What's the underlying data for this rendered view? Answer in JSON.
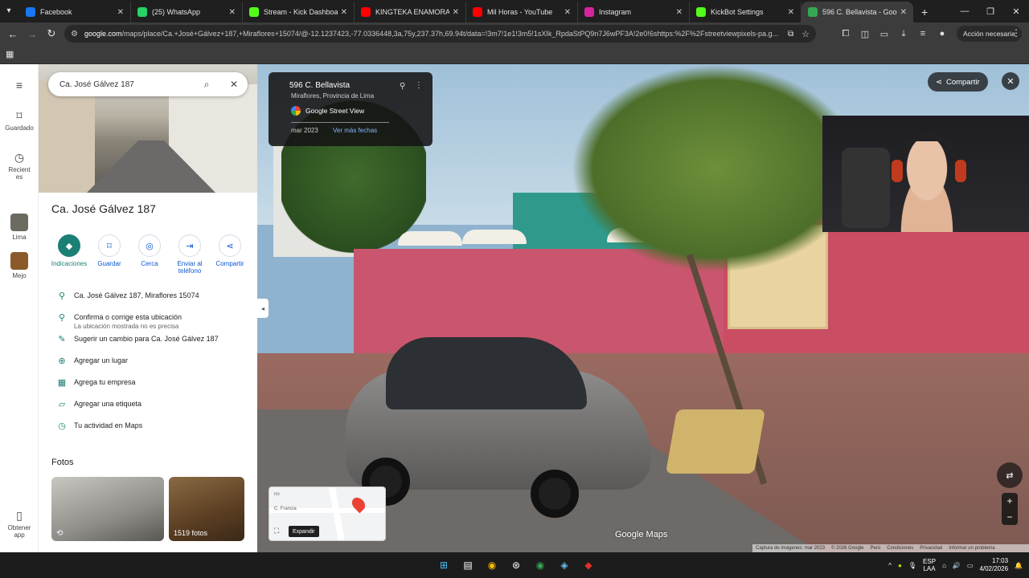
{
  "browser": {
    "tabs": [
      {
        "title": "Facebook",
        "color": "#1877f2",
        "active": false
      },
      {
        "title": "(25) WhatsApp",
        "color": "#25d366",
        "active": false
      },
      {
        "title": "Stream - Kick Dashboard",
        "color": "#53fc18",
        "active": false
      },
      {
        "title": "KINGTEKA ENAMORA",
        "color": "#ff0000",
        "active": false
      },
      {
        "title": "Mil Horas - YouTube",
        "color": "#ff0000",
        "active": false
      },
      {
        "title": "Instagram",
        "color": "#d6249f",
        "active": false
      },
      {
        "title": "KickBot Settings",
        "color": "#53fc18",
        "active": false
      },
      {
        "title": "596 C. Bellavista - Google",
        "color": "#34a853",
        "active": true
      }
    ],
    "url_host": "google.com",
    "url_rest": "/maps/place/Ca.+José+Gálvez+187,+Miraflores+15074/@-12.1237423,-77.0336448,3a,75y,237.37h,69.94t/data=!3m7!1e1!3m5!1sXIk_RpdaStPQ9n7J6wPF3A!2e0!6shttps:%2F%2Fstreetviewpixels-pa.g...",
    "action_label": "Acción necesaria"
  },
  "rail": {
    "items": [
      {
        "label": "Guardado",
        "icon": "bookmark-icon"
      },
      {
        "label": "Recientes",
        "icon": "history-icon"
      },
      {
        "label": "Lima",
        "icon": "thumbnail"
      },
      {
        "label": "Mejo",
        "icon": "thumbnail"
      },
      {
        "label": "Obtener app",
        "icon": "phone-icon"
      }
    ]
  },
  "panel": {
    "search_value": "Ca. José Gálvez 187",
    "title": "Ca. José Gálvez 187",
    "actions": [
      {
        "label": "Indicaciones",
        "icon": "directions-icon"
      },
      {
        "label": "Guardar",
        "icon": "bookmark-icon"
      },
      {
        "label": "Cerca",
        "icon": "nearby-icon"
      },
      {
        "label": "Enviar al teléfono",
        "icon": "send-to-phone-icon"
      },
      {
        "label": "Compartir",
        "icon": "share-icon"
      }
    ],
    "info": [
      {
        "text": "Ca. José Gálvez 187, Miraflores 15074",
        "sub": "",
        "icon": "location-pin-icon"
      },
      {
        "text": "Confirma o corrige esta ubicación",
        "sub": "La ubicación mostrada no es precisa",
        "icon": "location-pin-icon"
      },
      {
        "text": "Sugerir un cambio para Ca. José Gálvez 187",
        "sub": "",
        "icon": "pencil-icon"
      },
      {
        "text": "Agregar un lugar",
        "sub": "",
        "icon": "add-place-icon"
      },
      {
        "text": "Agrega tu empresa",
        "sub": "",
        "icon": "business-icon"
      },
      {
        "text": "Agregar una etiqueta",
        "sub": "",
        "icon": "label-icon"
      },
      {
        "text": "Tu actividad en Maps",
        "sub": "",
        "icon": "history-icon"
      }
    ],
    "photos_title": "Fotos",
    "photos_count_label": "1519 fotos"
  },
  "streetview": {
    "card_title": "596 C. Bellavista",
    "card_subtitle": "Miraflores, Provincia de Lima",
    "card_source": "Google Street View",
    "card_date": "mar 2023",
    "card_more_dates": "Ver más fechas",
    "share_label": "Compartir",
    "minimap_expand": "Expandir",
    "minimap_street_1": "C. Francia",
    "minimap_street_2": "no",
    "watermark": "Google Maps",
    "footer": [
      "Captura de imágenes: mar 2023",
      "© 2026 Google",
      "Perú",
      "Condiciones",
      "Privacidad",
      "Informar un problema"
    ]
  },
  "taskbar": {
    "lang_1": "ESP",
    "lang_2": "LAA",
    "time": "17:03",
    "date": "4/02/2026"
  }
}
